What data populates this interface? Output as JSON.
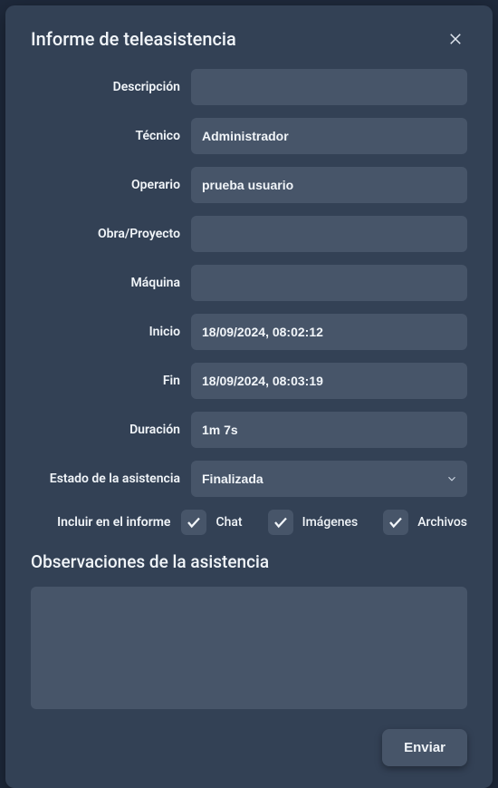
{
  "modal": {
    "title": "Informe de teleasistencia"
  },
  "fields": {
    "descripcion": {
      "label": "Descripción",
      "value": ""
    },
    "tecnico": {
      "label": "Técnico",
      "value": "Administrador"
    },
    "operario": {
      "label": "Operario",
      "value": "prueba usuario"
    },
    "obra": {
      "label": "Obra/Proyecto",
      "value": ""
    },
    "maquina": {
      "label": "Máquina",
      "value": ""
    },
    "inicio": {
      "label": "Inicio",
      "value": "18/09/2024, 08:02:12"
    },
    "fin": {
      "label": "Fin",
      "value": "18/09/2024, 08:03:19"
    },
    "duracion": {
      "label": "Duración",
      "value": "1m 7s"
    },
    "estado": {
      "label": "Estado de la asistencia",
      "value": "Finalizada"
    }
  },
  "includes": {
    "label": "Incluir en el informe",
    "chat": "Chat",
    "imagenes": "Imágenes",
    "archivos": "Archivos"
  },
  "observaciones": {
    "title": "Observaciones de la asistencia",
    "value": ""
  },
  "buttons": {
    "submit": "Enviar"
  }
}
